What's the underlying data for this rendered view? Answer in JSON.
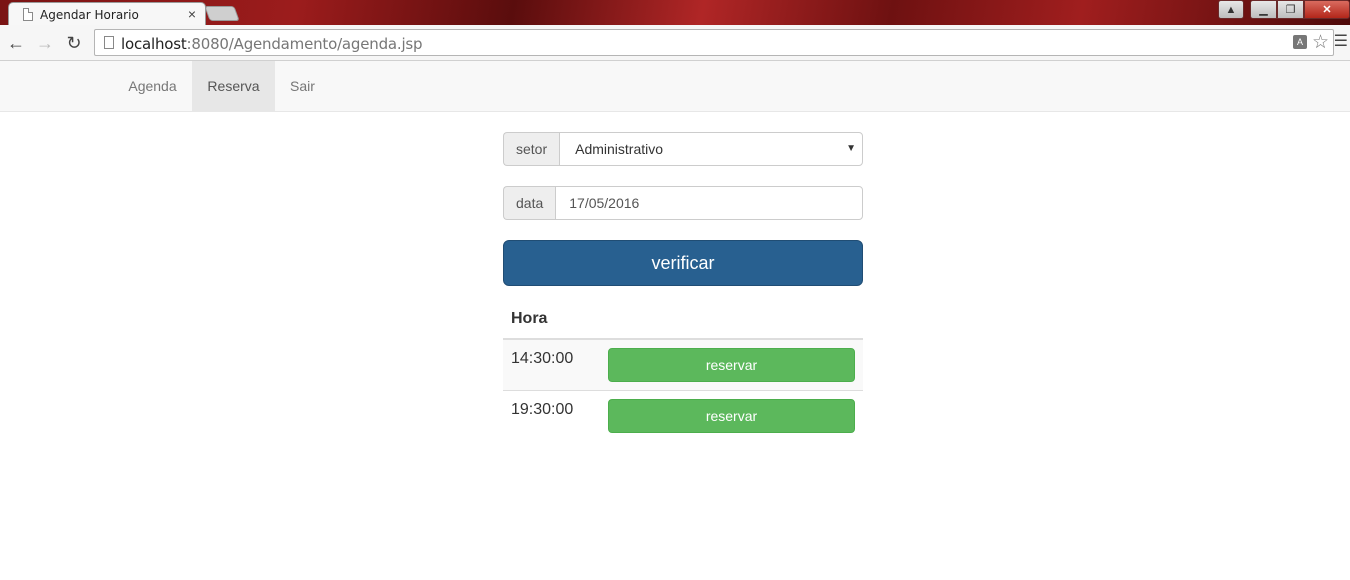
{
  "browser": {
    "tab_title": "Agendar Horario",
    "tab_close": "×",
    "url_host": "localhost",
    "url_rest": ":8080/Agendamento/agenda.jsp",
    "window_controls": {
      "minimize": "▁",
      "maximize": "❐",
      "close": "✕"
    }
  },
  "navbar": {
    "items": [
      {
        "label": "Agenda",
        "active": false
      },
      {
        "label": "Reserva",
        "active": true
      },
      {
        "label": "Sair",
        "active": false
      }
    ]
  },
  "form": {
    "setor_label": "setor",
    "setor_value": "Administrativo",
    "data_label": "data",
    "data_value": "17/05/2016",
    "submit_label": "verificar"
  },
  "table": {
    "header": "Hora",
    "rows": [
      {
        "hora": "14:30:00",
        "action": "reservar"
      },
      {
        "hora": "19:30:00",
        "action": "reservar"
      }
    ]
  },
  "colors": {
    "primary": "#286090",
    "success": "#5cb85c"
  }
}
